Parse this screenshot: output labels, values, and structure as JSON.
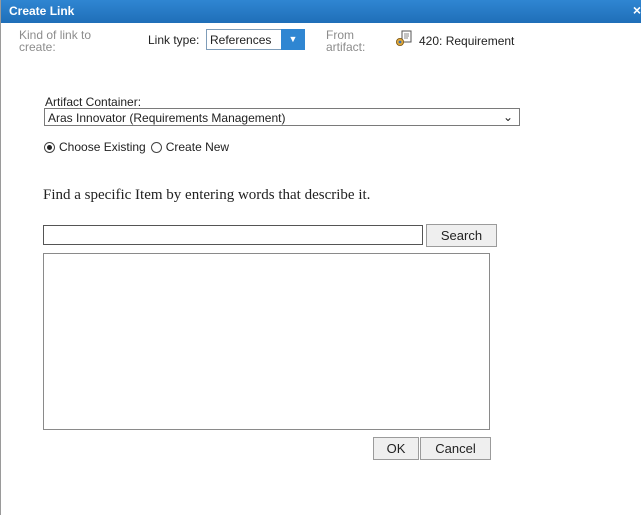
{
  "dialog": {
    "title": "Create Link",
    "close_glyph": "×"
  },
  "link_bar": {
    "kind_label": "Kind of link to create:",
    "link_type_label": "Link type:",
    "link_type_value": "References",
    "from_label": "From artifact:",
    "artifact_icon": "requirement-icon",
    "artifact_name": "420: Requirement"
  },
  "artifact_container": {
    "label": "Artifact Container:",
    "value": "Aras Innovator (Requirements Management)"
  },
  "mode": {
    "choose_existing": "Choose Existing",
    "create_new": "Create New",
    "selected": "choose_existing"
  },
  "search": {
    "instruction": "Find a specific Item by entering words that describe it.",
    "value": "",
    "button_label": "Search"
  },
  "results": [],
  "footer": {
    "ok_label": "OK",
    "cancel_label": "Cancel"
  },
  "colors": {
    "title_bar": "#2f86d2",
    "dropdown_button": "#2f86d2"
  }
}
